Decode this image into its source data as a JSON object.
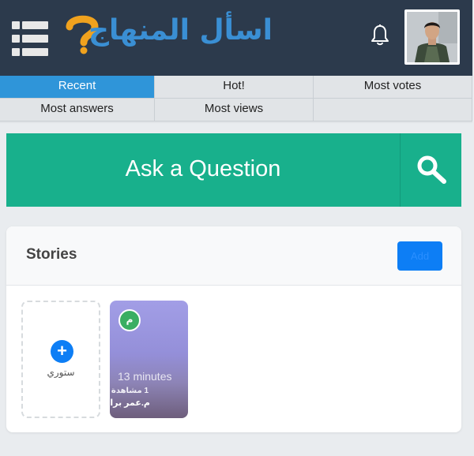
{
  "header": {
    "logo_text": "اسأل المنهاج",
    "logo_q": "؟",
    "menu_icon": "grid-menu-icon",
    "bell_icon": "bell-icon",
    "avatar_icon": "user-avatar",
    "colors": {
      "bar": "#2c3a4c",
      "logo_blue": "#3a8fd4",
      "logo_orange": "#f0a21e"
    }
  },
  "tabs": [
    {
      "label": "Recent",
      "active": true
    },
    {
      "label": "Hot!",
      "active": false
    },
    {
      "label": "Most votes",
      "active": false
    },
    {
      "label": "Most answers",
      "active": false
    },
    {
      "label": "Most views",
      "active": false
    }
  ],
  "ask": {
    "label": "Ask a Question",
    "search_icon": "search-icon",
    "color": "#18b08c"
  },
  "stories": {
    "title": "Stories",
    "add_label": "Add",
    "add_story_label": "ستوري",
    "add_icon": "plus-icon",
    "items": [
      {
        "initial": "م",
        "time": "13 minutes",
        "views": "1 مشاهدة",
        "author": "م.عمر برادعية"
      }
    ]
  }
}
